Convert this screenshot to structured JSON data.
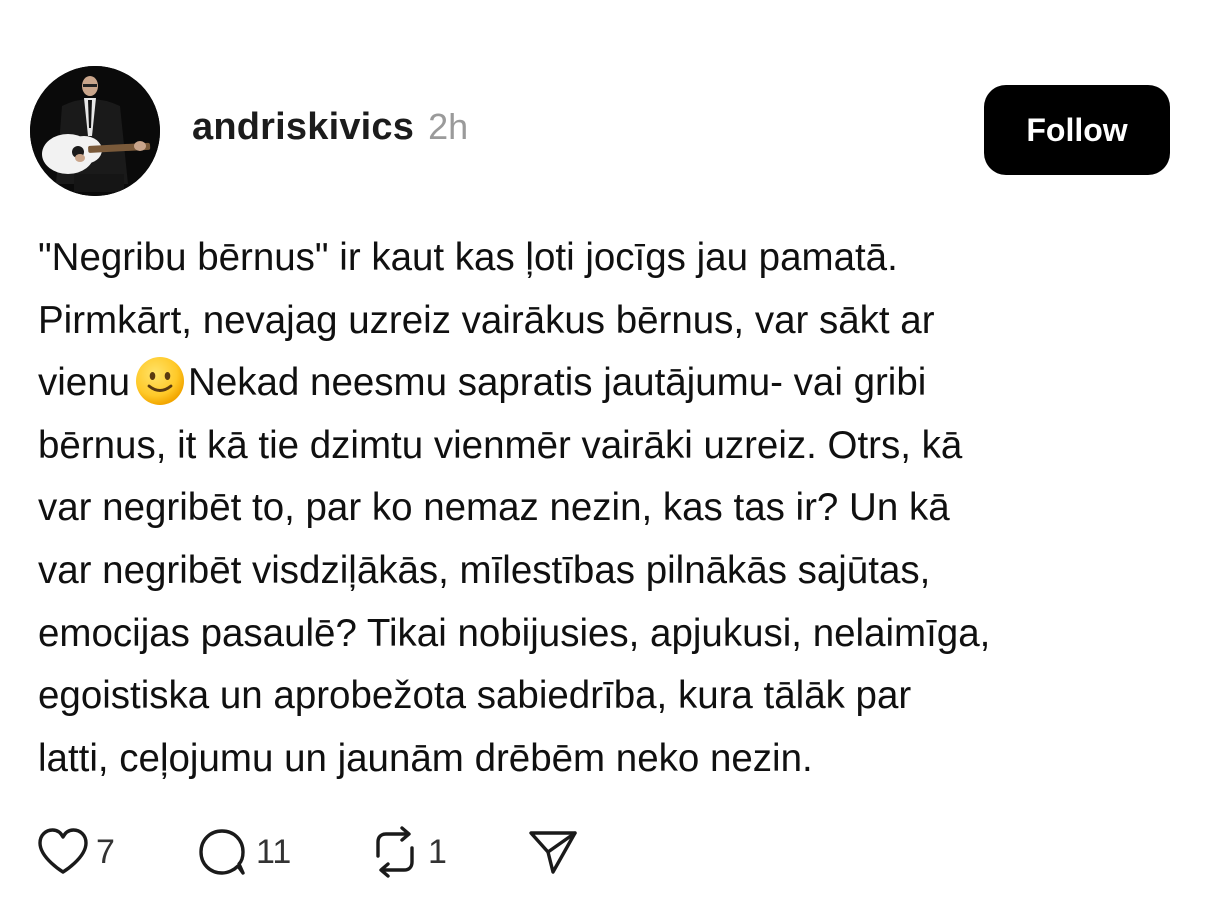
{
  "post": {
    "author": {
      "username": "andriskivics",
      "timestamp": "2h"
    },
    "follow_label": "Follow",
    "text_lines": [
      "\"Negribu bērnus\" ir kaut kas ļoti jocīgs jau pamatā.",
      "Pirmkārt, nevajag uzreiz vairākus bērnus, var sākt ar",
      "Nekad neesmu sapratis jautājumu- vai gribi",
      "bērnus, it kā tie dzimtu vienmēr vairāki uzreiz. Otrs, kā",
      "var negribēt to, par ko nemaz nezin, kas tas ir? Un kā",
      "var negribēt visdziļākās, mīlestības pilnākās sajūtas,",
      "emocijas pasaulē? Tikai nobijusies, apjukusi, nelaimīga,",
      "egoistiska un aprobežota sabiedrība, kura tālāk par",
      "latti, ceļojumu un jaunām drēbēm neko nezin."
    ],
    "line3_prefix": "vienu",
    "actions": {
      "likes": "7",
      "replies": "11",
      "reposts": "1"
    },
    "icons": {
      "like": "heart-icon",
      "reply": "speech-bubble-icon",
      "repost": "repost-icon",
      "share": "paper-plane-icon",
      "emoji": "slightly-smiling-face-emoji"
    }
  }
}
